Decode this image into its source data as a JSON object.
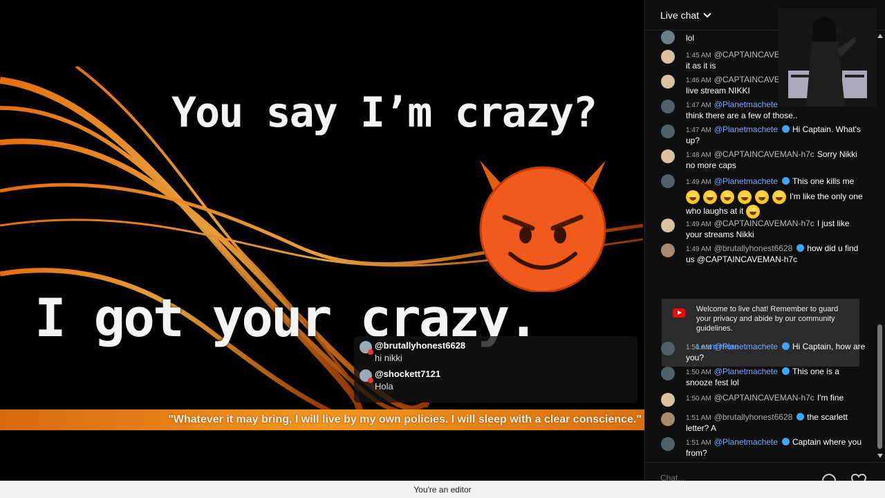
{
  "video": {
    "headline_top": "You say I’m crazy?",
    "headline_bottom": "I got your crazy.",
    "banner_quote": "\"Whatever it may bring, I will live by my own policies. I will sleep with a clear conscience.\"",
    "banner_color": "#f2951d",
    "overlay_messages": [
      {
        "user": "@brutallyhonest6628",
        "text": "hi nikki"
      },
      {
        "user": "@shockett7121",
        "text": "Hola"
      }
    ]
  },
  "chat": {
    "header_title": "Live chat",
    "input_placeholder": "Chat...",
    "messages": [
      {
        "time": "",
        "user": "",
        "text": "lol"
      },
      {
        "time": "1:45 AM",
        "user": "@CAPTAINCAVE",
        "text": "it as it is"
      },
      {
        "time": "1:46 AM",
        "user": "@CAPTAINCAVE",
        "text": "live stream NIKKI"
      },
      {
        "time": "1:47 AM",
        "user": "@Planetmachete",
        "text": "think there are a few of those.."
      },
      {
        "time": "1:47 AM",
        "user": "@Planetmachete",
        "text": "Hi Captain. What's up?"
      },
      {
        "time": "1:48 AM",
        "user": "@CAPTAINCAVEMAN-h7c",
        "text": "Sorry Nikki no more caps"
      },
      {
        "time": "1:49 AM",
        "user": "@Planetmachete",
        "text": "This one kills me",
        "text2": "I'm like the only one who laughs at it"
      },
      {
        "time": "1:49 AM",
        "user": "@CAPTAINCAVEMAN-h7c",
        "text": "I just like your streams Nikki"
      },
      {
        "time": "1:49 AM",
        "user": "@brutallyhonest6628",
        "text": "how did u find us @CAPTAINCAVEMAN-h7c"
      },
      {
        "time": "1:50 AM",
        "user": "@Planetmachete",
        "text": "Hi Captain, how are you?"
      },
      {
        "time": "1:50 AM",
        "user": "@Planetmachete",
        "text": "This one is a snooze fest lol"
      },
      {
        "time": "1:50 AM",
        "user": "@CAPTAINCAVEMAN-h7c",
        "text": "I'm fine"
      },
      {
        "time": "1:51 AM",
        "user": "@brutallyhonest6628",
        "text": "the scarlett letter? A"
      },
      {
        "time": "1:51 AM",
        "user": "@Planetmachete",
        "text": "Captain where you from?"
      }
    ],
    "welcome": {
      "text": "Welcome to live chat! Remember to guard your privacy and abide by our community guidelines.",
      "link": "Learn more"
    }
  },
  "status_bar": {
    "text": "You're an editor"
  }
}
